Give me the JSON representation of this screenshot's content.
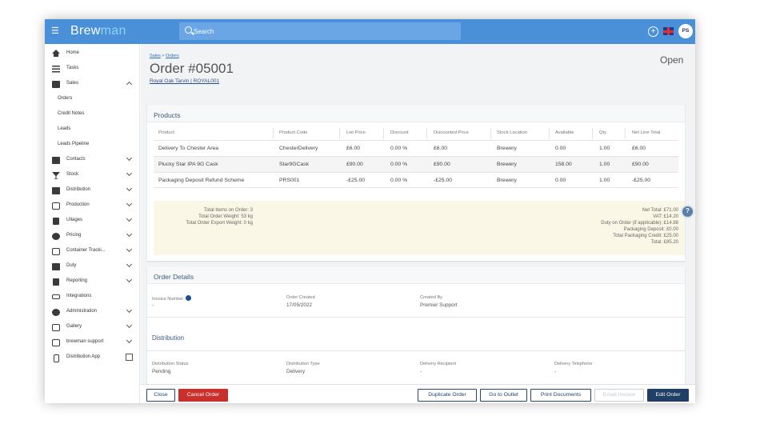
{
  "app": {
    "logo_part1": "Brew",
    "logo_part2": "man",
    "search_placeholder": "Search",
    "avatar_initials": "PS",
    "plus_label": "+"
  },
  "sidebar": {
    "items": [
      {
        "label": "Home",
        "icon": "home-icon"
      },
      {
        "label": "Tasks",
        "icon": "list-icon"
      },
      {
        "label": "Sales",
        "icon": "basket-icon",
        "expanded": true
      },
      {
        "label": "Orders",
        "sub": true
      },
      {
        "label": "Credit Notes",
        "sub": true
      },
      {
        "label": "Leads",
        "sub": true
      },
      {
        "label": "Leads Pipeline",
        "sub": true
      },
      {
        "label": "Contacts",
        "icon": "contacts-icon"
      },
      {
        "label": "Stock",
        "icon": "glass-icon"
      },
      {
        "label": "Distribution",
        "icon": "truck-icon"
      },
      {
        "label": "Production",
        "icon": "production-icon"
      },
      {
        "label": "Ullages",
        "icon": "bin-icon"
      },
      {
        "label": "Pricing",
        "icon": "pricing-icon"
      },
      {
        "label": "Container Tracki...",
        "icon": "target-icon"
      },
      {
        "label": "Duty",
        "icon": "duty-icon"
      },
      {
        "label": "Reporting",
        "icon": "report-icon"
      },
      {
        "label": "Integrations",
        "icon": "link-icon"
      },
      {
        "label": "Administration",
        "icon": "gear-icon"
      },
      {
        "label": "Gallery",
        "icon": "gallery-icon"
      },
      {
        "label": "brewman support",
        "icon": "support-icon"
      },
      {
        "label": "Distribution App",
        "icon": "phone-icon"
      }
    ]
  },
  "header": {
    "breadcrumb_root": "Sales",
    "breadcrumb_sep": " > ",
    "breadcrumb_current": "Orders",
    "title": "Order #05001",
    "customer": "Royal Oak Tarvin | ROYAL001",
    "status": "Open"
  },
  "products": {
    "title": "Products",
    "columns": [
      "Product",
      "Product Code",
      "List Price",
      "Discount",
      "Discounted Price",
      "Stock Location",
      "Available",
      "Qty",
      "Net Line Total"
    ],
    "rows": [
      [
        "Delivery To Chester Area",
        "ChesterDelivery",
        "£6.00",
        "0.00 %",
        "£6.00",
        "Brewery",
        "0.00",
        "1.00",
        "£6.00"
      ],
      [
        "Plucky Star IPA 9G Cask",
        "Star9GCask",
        "£90.00",
        "0.00 %",
        "£90.00",
        "Brewery",
        "158.00",
        "1.00",
        "£90.00"
      ],
      [
        "Packaging Deposit Refund Scheme",
        "PRS001",
        "-£25.00",
        "0.00 %",
        "-£25.00",
        "Brewery",
        "0.00",
        "1.00",
        "-£25.00"
      ]
    ],
    "totals_left": [
      "Total Items on Order: 3",
      "Total Order Weight: 53 kg",
      "Total Order Export Weight: 0 kg"
    ],
    "totals_right": [
      "Net Total: £71.00",
      "VAT: £14.20",
      "Duty on Order (if applicable): £14.88",
      "Packaging Deposit: £0.00",
      "Total Packaging Credit: £25.00",
      "Total: £85.20"
    ]
  },
  "order_details": {
    "title": "Order Details",
    "invoice_label": "Invoice Number",
    "invoice_value": "-",
    "created_label": "Order Created",
    "created_value": "17/05/2022",
    "created_by_label": "Created By",
    "created_by_value": "Premier Support",
    "distribution_title": "Distribution",
    "dist_status_label": "Distribution Status",
    "dist_status_value": "Pending",
    "dist_type_label": "Distribution Type",
    "dist_type_value": "Delivery",
    "recipient_label": "Delivery Recipient",
    "recipient_value": "-",
    "telephone_label": "Delivery Telephone",
    "telephone_value": "-"
  },
  "footer": {
    "close": "Close",
    "cancel": "Cancel Order",
    "duplicate": "Duplicate Order",
    "outlet": "Go to Outlet",
    "print": "Print Documents",
    "email": "Email Invoice",
    "edit": "Edit Order"
  },
  "colors": {
    "topbar": "#4a90d9",
    "danger": "#c9302c",
    "primary": "#1f3f66"
  }
}
